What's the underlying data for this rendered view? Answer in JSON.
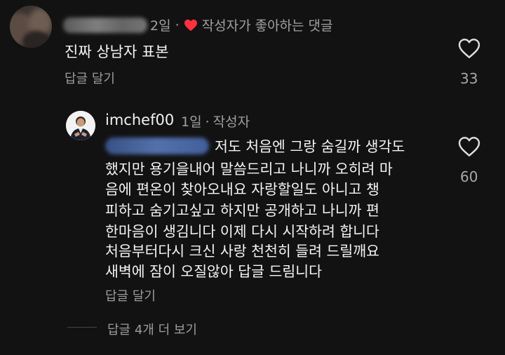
{
  "comment1": {
    "time": "2일",
    "creator_liked": "작성자가 좋아하는 댓글",
    "text": "진짜 상남자 표본",
    "reply_label": "답글 달기",
    "like_count": "33"
  },
  "comment2": {
    "username": "imchef00",
    "time": "1일",
    "author_badge": "작성자",
    "lines": [
      "저도 처음엔 그랑 숨길까 생각도",
      "했지만 용기을내어 말씀드리고 나니까 오히려 마",
      "음에 편온이 찾아오내요  자랑할일도 아니고 챙",
      "피하고 숨기고싶고  하지만 공개하고 나니까  편",
      "한마음이 생김니다 이제 다시 시작하려 합니다",
      "처음부터다시  크신 사랑 천천히 들려 드릴깨요",
      "새벽에 잠이 오질않아 답글 드림니다"
    ],
    "reply_label": "답글 달기",
    "like_count": "60"
  },
  "view_more": "답글 4개 더 보기",
  "colors": {
    "accent_red": "#ff3040",
    "background": "#121212",
    "mention_blue": "#5f82c7"
  },
  "icons": [
    "heart-filled-red-icon",
    "heart-outline-icon"
  ]
}
